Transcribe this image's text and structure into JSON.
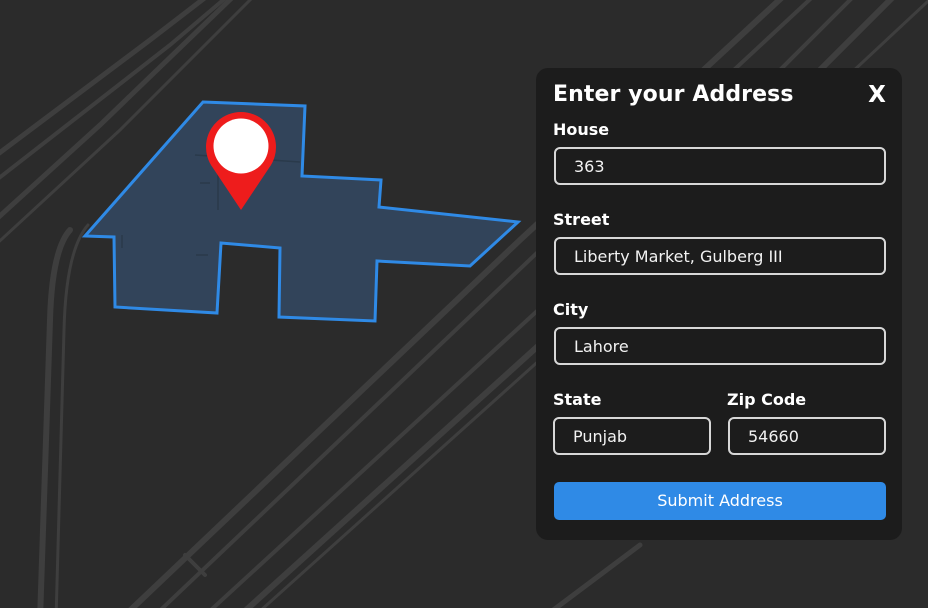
{
  "map": {
    "background_color": "#2b2b2b",
    "road_color": "#3d3d3d",
    "area_fill_color": "#33475e",
    "area_outline_color": "#2f8ae6",
    "marker_color": "#ee1c1c",
    "marker_icon": "map-pin-icon"
  },
  "form": {
    "title": "Enter your Address",
    "close_label": "X",
    "house": {
      "label": "House",
      "value": "363"
    },
    "street": {
      "label": "Street",
      "value": "Liberty Market, Gulberg III"
    },
    "city": {
      "label": "City",
      "value": "Lahore"
    },
    "state": {
      "label": "State",
      "value": "Punjab"
    },
    "zip": {
      "label": "Zip Code",
      "value": "54660"
    },
    "submit_label": "Submit Address",
    "accent_color": "#2f8ae6"
  }
}
